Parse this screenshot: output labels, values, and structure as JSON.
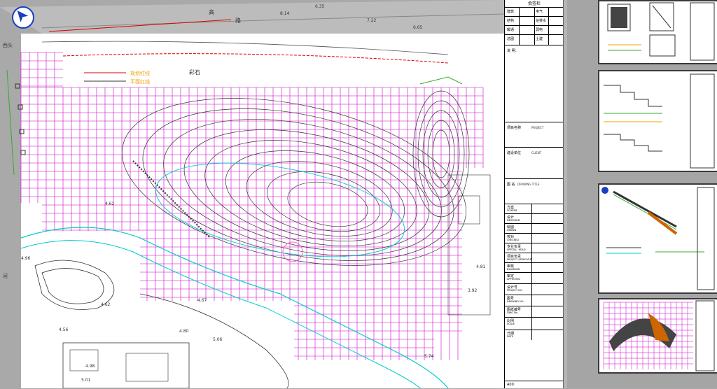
{
  "drawing": {
    "road_label_1": "高",
    "road_label_2": "路",
    "stone_label": "彩石",
    "legend_1": "规划红线",
    "legend_2": "平面红线",
    "left_label": "西头",
    "bottom_label": "河",
    "elevations": [
      "4.62",
      "4.56",
      "4.98",
      "4.67",
      "4.80",
      "5.06",
      "3.92",
      "4.81",
      "5.74",
      "5.01",
      "4.96",
      "4.62",
      "6.35",
      "6.65",
      "8.14",
      "7.22"
    ]
  },
  "title_block": {
    "header": "会签栏",
    "rows": [
      {
        "left": "建筑",
        "right": "电气"
      },
      {
        "left": "结构",
        "right": "给排水"
      },
      {
        "left": "暖通",
        "right": "弱电"
      },
      {
        "left": "总图",
        "right": "土建"
      }
    ],
    "notes_label": "说 明：",
    "project_name": "项目名称",
    "project_name_en": "PROJECT",
    "client": "建设单位",
    "client_en": "CLIENT",
    "drawing_title": "图 名",
    "drawing_title_en": "DRAWING TITLE",
    "staff": [
      {
        "cn": "方案",
        "en": "SCHEME"
      },
      {
        "cn": "设计",
        "en": "DESIGNED"
      },
      {
        "cn": "绘图",
        "en": "DRAWN"
      },
      {
        "cn": "校对",
        "en": "CHECKED"
      },
      {
        "cn": "专业负责",
        "en": "SPECIAL. HEAD"
      },
      {
        "cn": "项目负责",
        "en": "PROJECT APPROVED"
      },
      {
        "cn": "审核",
        "en": "EXAMINED"
      },
      {
        "cn": "审定",
        "en": "APPROVED"
      },
      {
        "cn": "设计号",
        "en": "PROJECT NO."
      },
      {
        "cn": "图号",
        "en": "DRAWING NO."
      },
      {
        "cn": "图纸编号",
        "en": "DWG No."
      },
      {
        "cn": "比例",
        "en": "SCALE"
      },
      {
        "cn": "日期",
        "en": "DATE"
      }
    ],
    "footer": "A00"
  },
  "colors": {
    "grid": "#cc00cc",
    "contour": "#333333",
    "water": "#00cccc",
    "label": "#f0a000",
    "green": "#33aa33",
    "red": "#dd0000"
  }
}
